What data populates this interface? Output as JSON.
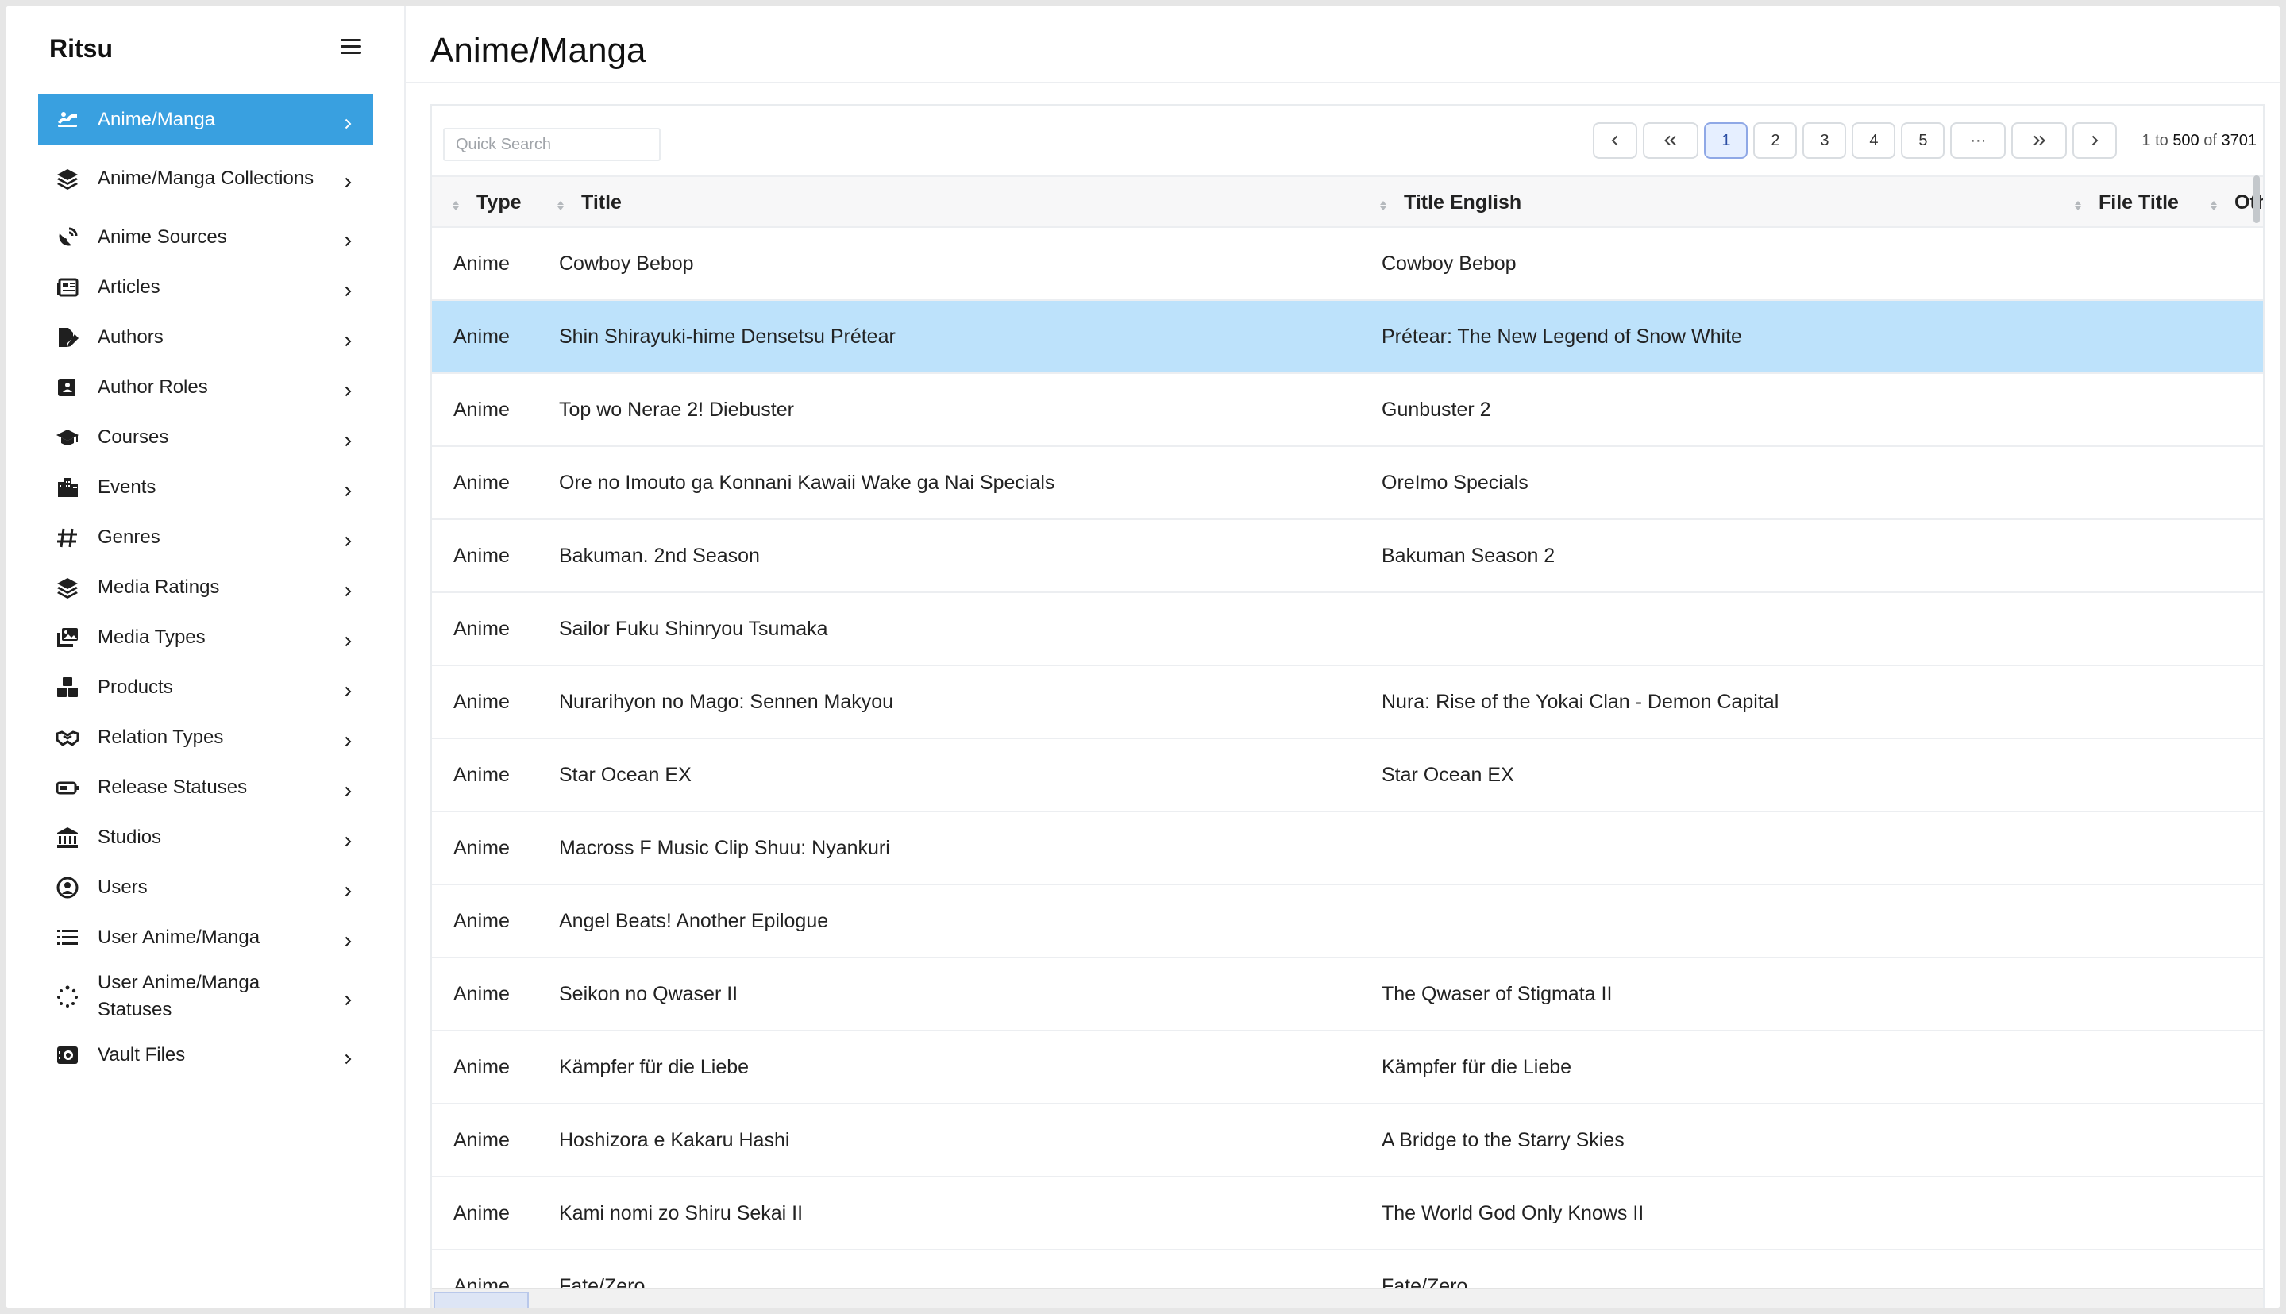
{
  "app": {
    "brand": "Ritsu"
  },
  "sidebar": {
    "items": [
      {
        "label": "Anime/Manga",
        "icon": "anime-manga-icon",
        "active": true
      },
      {
        "label": "Anime/Manga Collections",
        "icon": "layers-icon"
      },
      {
        "label": "Anime Sources",
        "icon": "satellite-dish-icon"
      },
      {
        "label": "Articles",
        "icon": "newspaper-icon"
      },
      {
        "label": "Authors",
        "icon": "file-signature-icon"
      },
      {
        "label": "Author Roles",
        "icon": "book-user-icon"
      },
      {
        "label": "Courses",
        "icon": "graduation-cap-icon"
      },
      {
        "label": "Events",
        "icon": "building-icon"
      },
      {
        "label": "Genres",
        "icon": "hashtag-icon"
      },
      {
        "label": "Media Ratings",
        "icon": "layers-icon"
      },
      {
        "label": "Media Types",
        "icon": "photo-film-icon"
      },
      {
        "label": "Products",
        "icon": "boxes-icon"
      },
      {
        "label": "Relation Types",
        "icon": "handshake-icon"
      },
      {
        "label": "Release Statuses",
        "icon": "battery-icon"
      },
      {
        "label": "Studios",
        "icon": "landmark-icon"
      },
      {
        "label": "Users",
        "icon": "user-circle-icon"
      },
      {
        "label": "User Anime/Manga",
        "icon": "list-icon"
      },
      {
        "label": "User Anime/Manga Statuses",
        "icon": "spinner-icon"
      },
      {
        "label": "Vault Files",
        "icon": "vault-icon"
      }
    ]
  },
  "page": {
    "title": "Anime/Manga"
  },
  "search": {
    "placeholder": "Quick Search"
  },
  "pagination": {
    "pages": [
      "1",
      "2",
      "3",
      "4",
      "5"
    ],
    "active_page": "1",
    "ellipsis": "···",
    "range_prefix": "1 to",
    "range_end": "500",
    "range_of": "of",
    "total": "3701"
  },
  "table": {
    "columns": [
      "Type",
      "Title",
      "Title English",
      "File Title",
      "Oth"
    ],
    "rows": [
      {
        "type": "Anime",
        "title": "Cowboy Bebop",
        "title_english": "Cowboy Bebop"
      },
      {
        "type": "Anime",
        "title": "Shin Shirayuki-hime Densetsu Prétear",
        "title_english": "Prétear: The New Legend of Snow White",
        "selected": true
      },
      {
        "type": "Anime",
        "title": "Top wo Nerae 2! Diebuster",
        "title_english": "Gunbuster 2"
      },
      {
        "type": "Anime",
        "title": "Ore no Imouto ga Konnani Kawaii Wake ga Nai Specials",
        "title_english": "OreImo Specials"
      },
      {
        "type": "Anime",
        "title": "Bakuman. 2nd Season",
        "title_english": "Bakuman Season 2"
      },
      {
        "type": "Anime",
        "title": "Sailor Fuku Shinryou Tsumaka",
        "title_english": ""
      },
      {
        "type": "Anime",
        "title": "Nurarihyon no Mago: Sennen Makyou",
        "title_english": "Nura: Rise of the Yokai Clan - Demon Capital"
      },
      {
        "type": "Anime",
        "title": "Star Ocean EX",
        "title_english": "Star Ocean EX"
      },
      {
        "type": "Anime",
        "title": "Macross F Music Clip Shuu: Nyankuri",
        "title_english": ""
      },
      {
        "type": "Anime",
        "title": "Angel Beats! Another Epilogue",
        "title_english": ""
      },
      {
        "type": "Anime",
        "title": "Seikon no Qwaser II",
        "title_english": "The Qwaser of Stigmata II"
      },
      {
        "type": "Anime",
        "title": "Kämpfer für die Liebe",
        "title_english": "Kämpfer für die Liebe"
      },
      {
        "type": "Anime",
        "title": "Hoshizora e Kakaru Hashi",
        "title_english": "A Bridge to the Starry Skies"
      },
      {
        "type": "Anime",
        "title": "Kami nomi zo Shiru Sekai II",
        "title_english": "The World God Only Knows II"
      },
      {
        "type": "Anime",
        "title": "Fate/Zero",
        "title_english": "Fate/Zero"
      }
    ]
  },
  "colors": {
    "accent": "#39a0e0",
    "selected_row": "#bde2fb",
    "active_page_bg": "#e6efff"
  }
}
